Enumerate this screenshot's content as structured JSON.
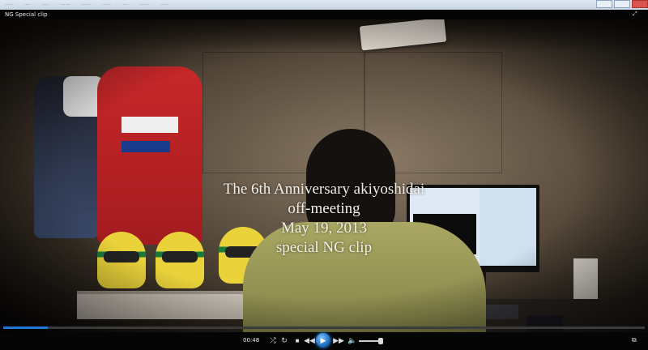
{
  "player": {
    "title": "NG Special clip",
    "caption_lines": [
      "The 6th Anniversary   akiyoshidai",
      "off-meeting",
      "May 19, 2013",
      "special NG clip"
    ],
    "time": "00:48",
    "seek_progress": 0.07,
    "volume_level": 0.9,
    "accent_color": "#1f78d6"
  },
  "icons": {
    "fullscreen": "fullscreen-icon",
    "shuffle": "shuffle-icon",
    "repeat": "repeat-icon",
    "stop": "stop-icon",
    "previous": "previous-icon",
    "play": "play-icon",
    "next": "next-icon",
    "volume": "volume-icon",
    "switch_to_library": "switch-view-icon"
  }
}
